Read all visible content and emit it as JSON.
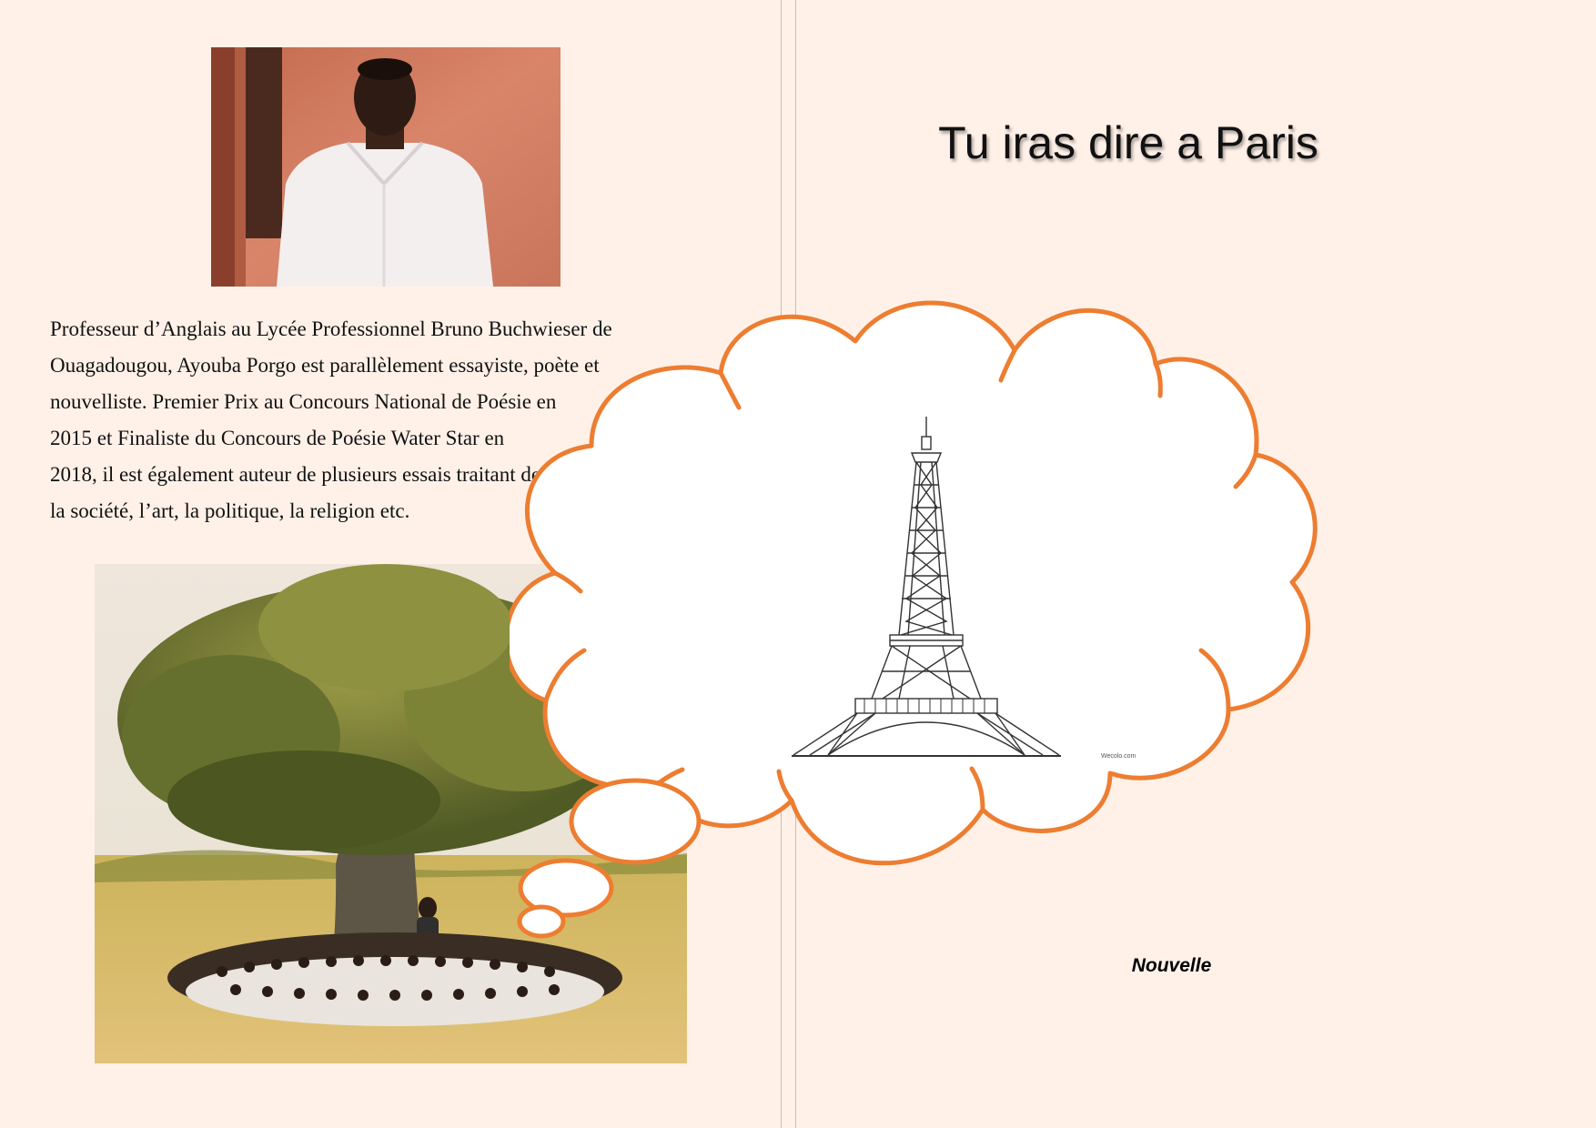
{
  "left_page": {
    "bio_lines": [
      "Professeur d’Anglais au Lycée Professionnel Bruno Buchwieser de",
      "Ouagadougou, Ayouba Porgo est parallèlement essayiste, poète et",
      "nouvelliste. Premier Prix au Concours National de Poésie en",
      "2015 et Finaliste du Concours de Poésie Water Star en",
      "2018, il est également auteur de plusieurs essais traitant de",
      "la société, l’art, la politique, la religion etc."
    ]
  },
  "right_page": {
    "title": "Tu iras dire a Paris",
    "subtitle": "Nouvelle",
    "image_credit": "Wecolo.com"
  },
  "colors": {
    "page_background": "#fff1e8",
    "cloud_outline": "#ed7d31",
    "cloud_fill": "#ffffff"
  },
  "icons": {
    "thought_cloud": "thought-bubble-icon",
    "tower": "eiffel-tower-icon"
  }
}
